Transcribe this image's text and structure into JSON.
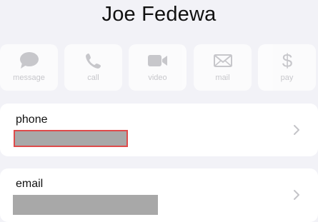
{
  "contact": {
    "name": "Joe Fedewa"
  },
  "actions": [
    {
      "label": "message",
      "icon": "message-bubble-icon"
    },
    {
      "label": "call",
      "icon": "phone-icon"
    },
    {
      "label": "video",
      "icon": "video-camera-icon"
    },
    {
      "label": "mail",
      "icon": "envelope-icon"
    },
    {
      "label": "pay",
      "icon": "dollar-icon"
    }
  ],
  "fields": {
    "phone": {
      "label": "phone",
      "value_redacted": true
    },
    "email": {
      "label": "email",
      "value_redacted": true
    }
  },
  "colors": {
    "background": "#f2f2f7",
    "card": "#ffffff",
    "disabled_icon": "#b7b7bb",
    "redaction": "#a8a8a8",
    "highlight_border": "#de4b4b"
  }
}
